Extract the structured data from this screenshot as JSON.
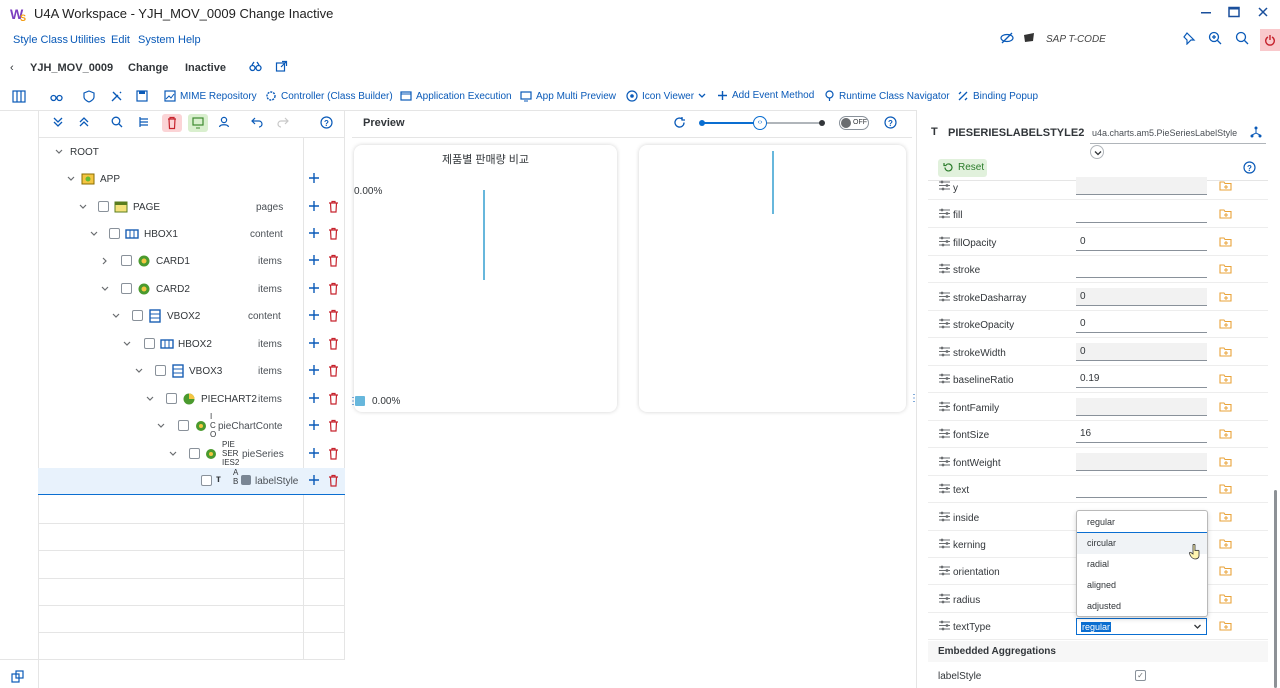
{
  "window": {
    "title": "U4A Workspace - YJH_MOV_0009 Change Inactive"
  },
  "menu": {
    "items": [
      "Style Class",
      "Utilities",
      "Edit",
      "System",
      "Help"
    ],
    "tcode_placeholder": "SAP T-CODE"
  },
  "header": {
    "app_name": "YJH_MOV_0009",
    "mode": "Change",
    "status": "Inactive"
  },
  "toolbar": {
    "mime": "MIME Repository",
    "controller": "Controller (Class Builder)",
    "app_exec": "Application Execution",
    "multi_preview": "App Multi Preview",
    "icon_viewer": "Icon Viewer",
    "add_event": "Add Event Method",
    "runtime_nav": "Runtime Class Navigator",
    "binding_popup": "Binding Popup"
  },
  "tree": {
    "rows": [
      {
        "label": "ROOT",
        "agg": ""
      },
      {
        "label": "APP",
        "agg": ""
      },
      {
        "label": "PAGE",
        "agg": "pages"
      },
      {
        "label": "HBOX1",
        "agg": "content"
      },
      {
        "label": "CARD1",
        "agg": "items"
      },
      {
        "label": "CARD2",
        "agg": "items"
      },
      {
        "label": "VBOX2",
        "agg": "content"
      },
      {
        "label": "HBOX2",
        "agg": "items"
      },
      {
        "label": "VBOX3",
        "agg": "items"
      },
      {
        "label": "PIECHART2",
        "agg": "items"
      },
      {
        "label": "I C O",
        "agg": "pieChartConte"
      },
      {
        "label": "PIE SER IES2",
        "agg": "pieSeries"
      },
      {
        "label": "A B",
        "agg": "labelStyle"
      }
    ]
  },
  "preview": {
    "title": "Preview",
    "toggle_label": "OFF",
    "chart_title": "제품별 판매량 비교",
    "pct_top": "0.00%",
    "legend_value": "0.00%"
  },
  "properties": {
    "class_name": "PIESERIESLABELSTYLE2",
    "class_path": "u4a.charts.am5.PieSeriesLabelStyle",
    "reset": "Reset",
    "rows": [
      {
        "name": "y",
        "value": ""
      },
      {
        "name": "fill",
        "value": ""
      },
      {
        "name": "fillOpacity",
        "value": "0"
      },
      {
        "name": "stroke",
        "value": ""
      },
      {
        "name": "strokeDasharray",
        "value": "0"
      },
      {
        "name": "strokeOpacity",
        "value": "0"
      },
      {
        "name": "strokeWidth",
        "value": "0"
      },
      {
        "name": "baselineRatio",
        "value": "0.19"
      },
      {
        "name": "fontFamily",
        "value": ""
      },
      {
        "name": "fontSize",
        "value": "16"
      },
      {
        "name": "fontWeight",
        "value": ""
      },
      {
        "name": "text",
        "value": ""
      },
      {
        "name": "inside",
        "value": ""
      },
      {
        "name": "kerning",
        "value": ""
      },
      {
        "name": "orientation",
        "value": ""
      },
      {
        "name": "radius",
        "value": ""
      },
      {
        "name": "textType",
        "value": "regular"
      }
    ],
    "dropdown_options": [
      "regular",
      "circular",
      "radial",
      "aligned",
      "adjusted"
    ],
    "embedded_title": "Embedded Aggregations",
    "embedded_item": "labelStyle"
  }
}
